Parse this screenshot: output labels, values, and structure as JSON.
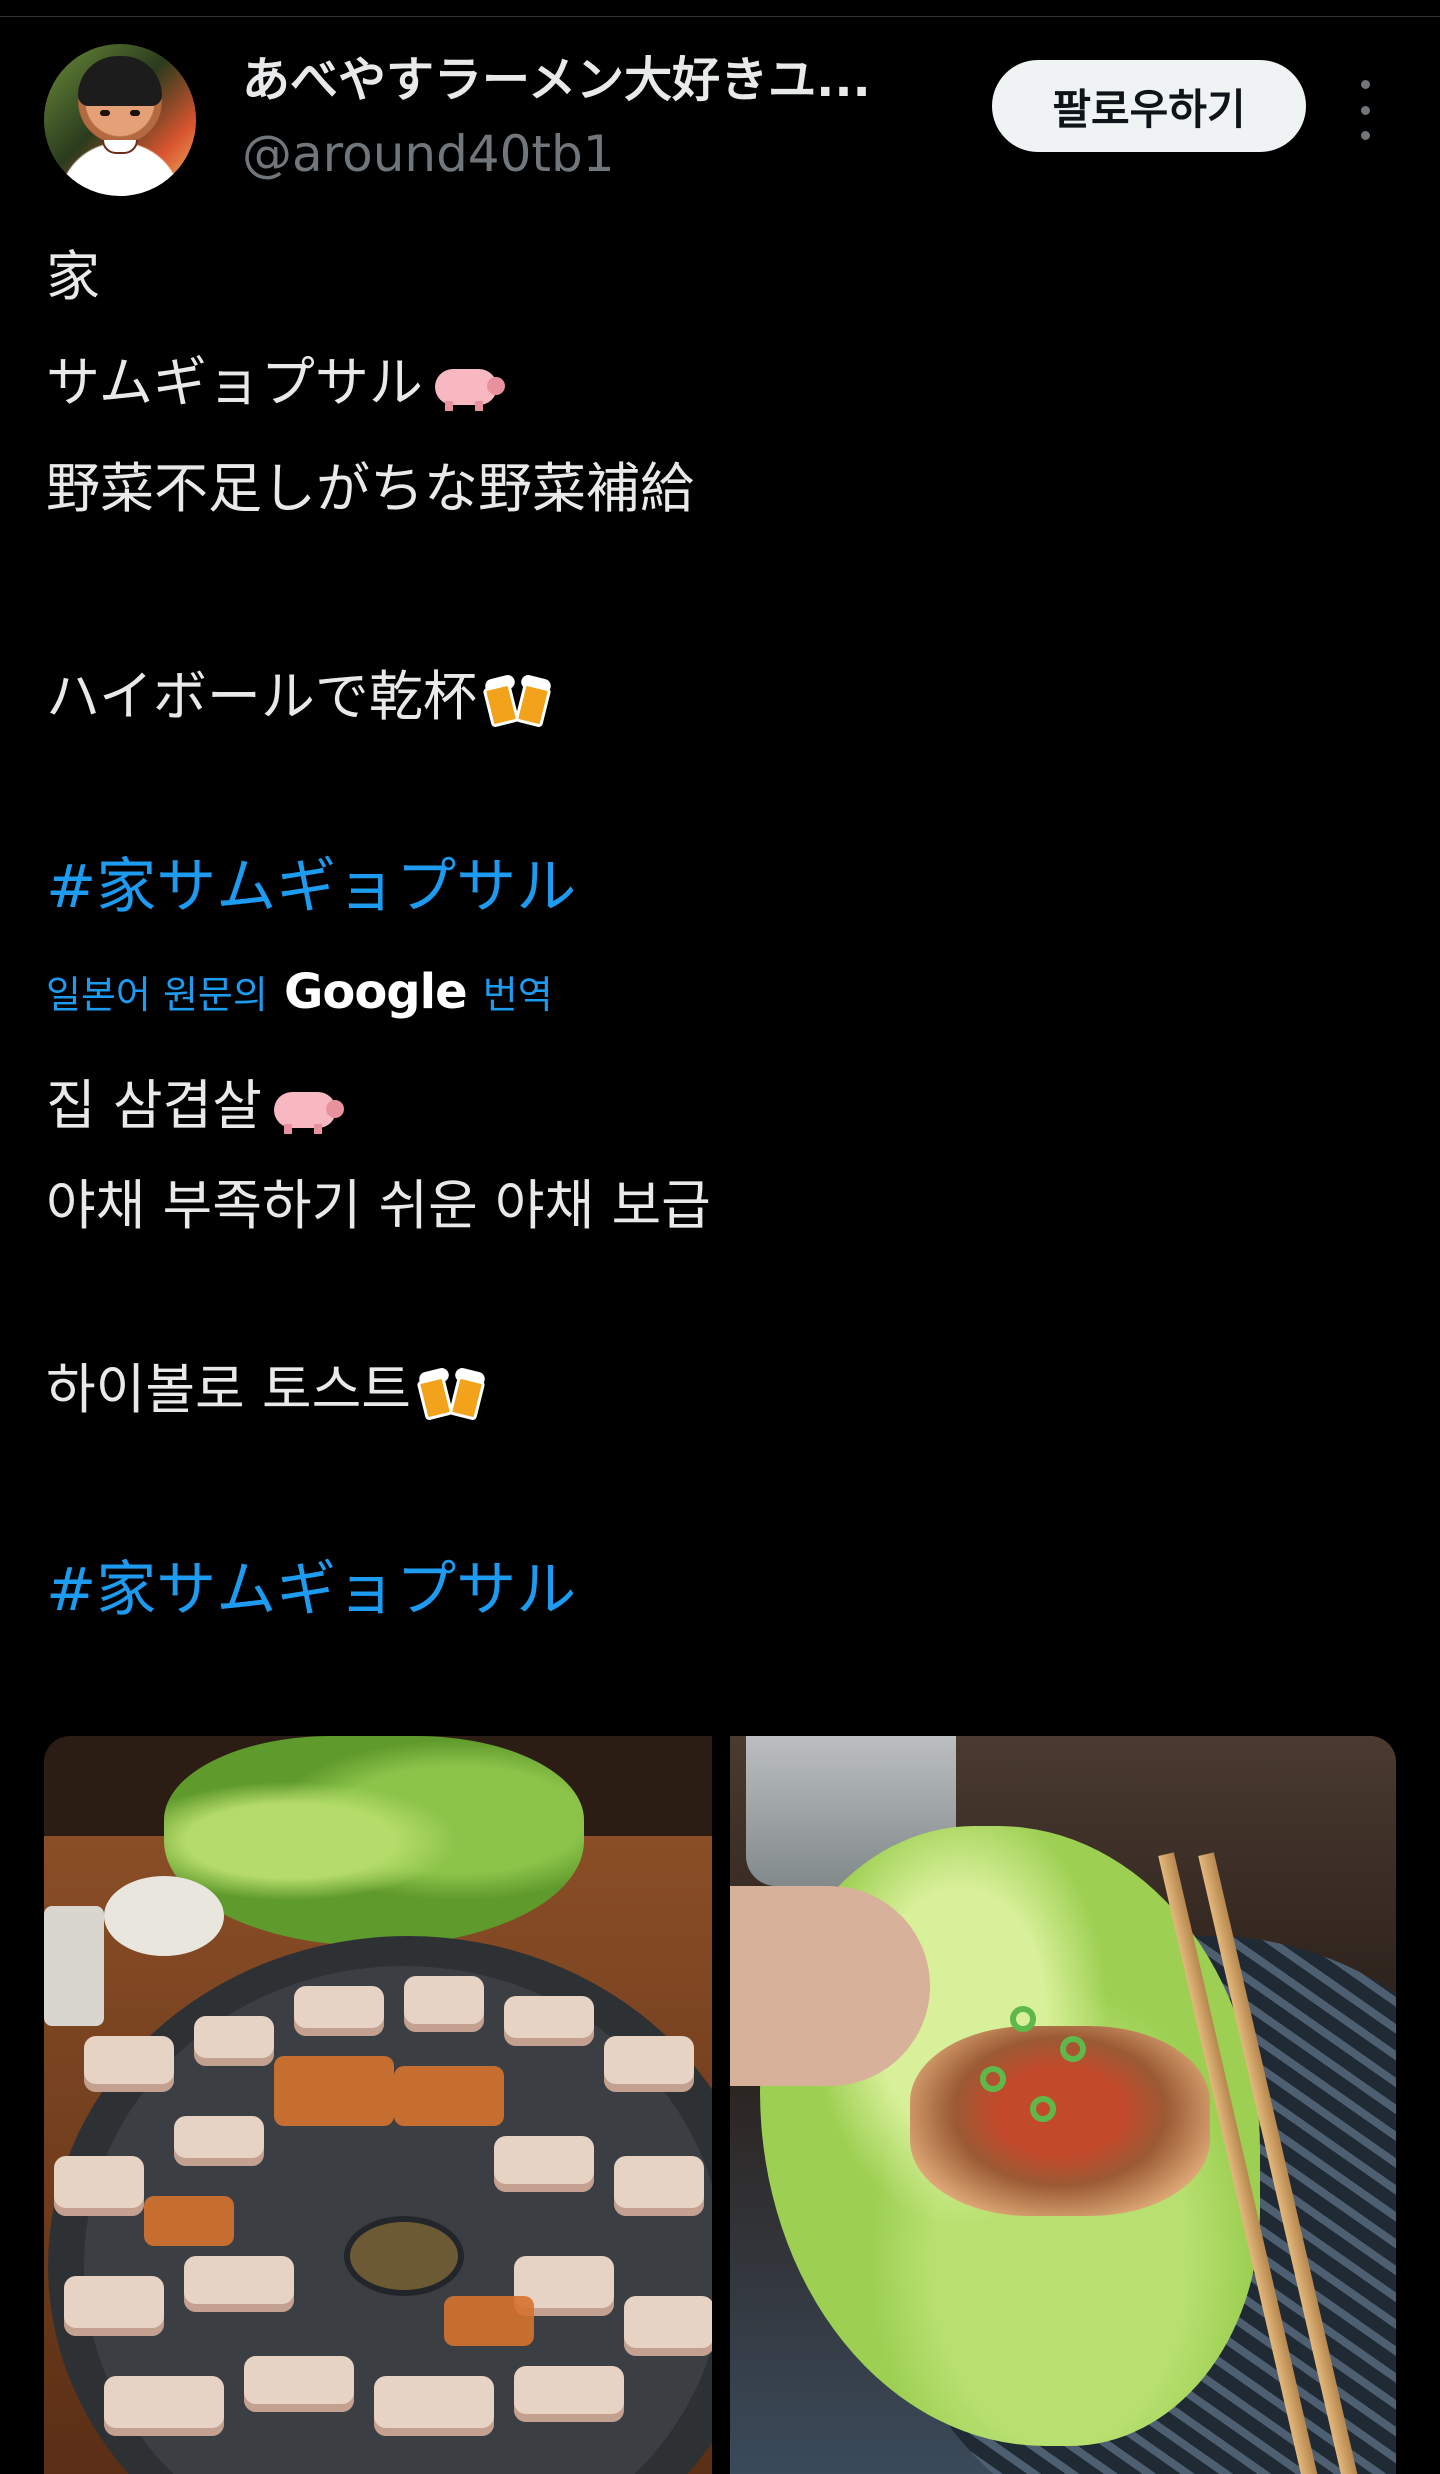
{
  "post": {
    "author": {
      "display_name": "あべやすラーメン大好きユ...",
      "handle": "@around40tb1"
    },
    "follow_label": "팔로우하기",
    "original_text": {
      "line1": "家",
      "line2": "サムギョプサル",
      "line3": "野菜不足しがちな野菜補給",
      "line4": "ハイボールで乾杯",
      "hashtag": "#家サムギョプサル"
    },
    "translation": {
      "link_prefix": "일본어 원문의",
      "link_brand": "Google",
      "link_suffix": "번역",
      "line1": "집 삼겹살",
      "line2": "야채 부족하기 쉬운 야채 보급",
      "line3": "하이볼로 토스트",
      "hashtag": "#家サムギョプサル"
    },
    "emoji": {
      "pig": "pig-emoji",
      "beer": "clinking-beer-mugs-emoji"
    },
    "media_count": 2
  },
  "colors": {
    "background": "#000000",
    "text": "#e7e9ea",
    "secondary_text": "#71767b",
    "link": "#1d9bf0",
    "button_bg": "#eff3f4"
  }
}
